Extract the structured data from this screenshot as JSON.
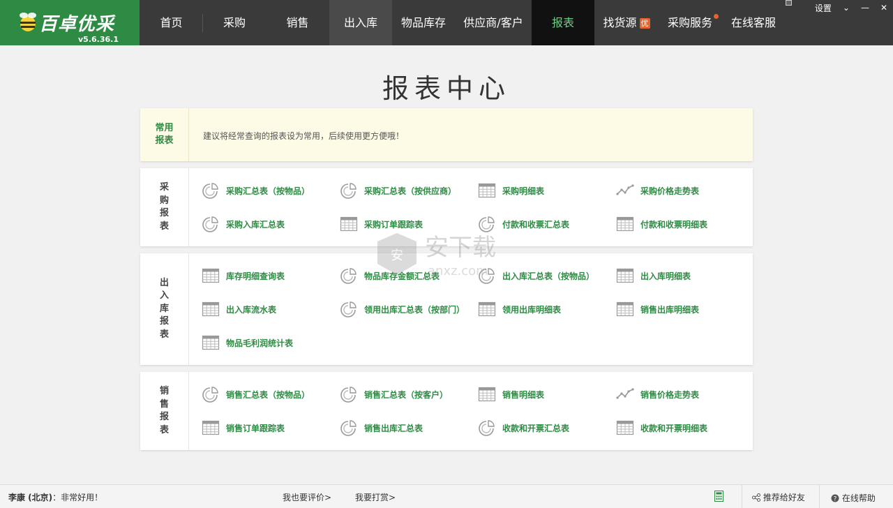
{
  "app": {
    "name": "百卓优采",
    "version": "v5.6.36.1"
  },
  "nav": [
    {
      "label": "首页"
    },
    {
      "label": "采购"
    },
    {
      "label": "销售"
    },
    {
      "label": "出入库"
    },
    {
      "label": "物品库存"
    },
    {
      "label": "供应商/客户"
    },
    {
      "label": "报表"
    },
    {
      "label": "找货源",
      "badge": "优"
    },
    {
      "label": "采购服务"
    },
    {
      "label": "在线客服"
    }
  ],
  "window": {
    "settings": "设置",
    "dropdown": "⌄",
    "minimize": "—",
    "close": "✕"
  },
  "title": "报表中心",
  "favorites": {
    "side": "常用报表",
    "tip": "建议将经常查询的报表设为常用，后续使用更方便哦！"
  },
  "sections": [
    {
      "side": [
        "采",
        "购",
        "报",
        "表"
      ],
      "items": [
        {
          "label": "采购汇总表（按物品）",
          "icon": "pie-chart-icon"
        },
        {
          "label": "采购汇总表（按供应商）",
          "icon": "pie-chart-icon"
        },
        {
          "label": "采购明细表",
          "icon": "table-grid-icon"
        },
        {
          "label": "采购价格走势表",
          "icon": "line-trend-icon"
        },
        {
          "label": "采购入库汇总表",
          "icon": "pie-chart-icon"
        },
        {
          "label": "采购订单跟踪表",
          "icon": "table-grid-icon"
        },
        {
          "label": "付款和收票汇总表",
          "icon": "pie-chart-icon"
        },
        {
          "label": "付款和收票明细表",
          "icon": "table-grid-icon"
        }
      ]
    },
    {
      "side": [
        "出",
        "入",
        "库",
        "报",
        "表"
      ],
      "items": [
        {
          "label": "库存明细查询表",
          "icon": "table-grid-icon"
        },
        {
          "label": "物品库存金额汇总表",
          "icon": "pie-chart-icon"
        },
        {
          "label": "出入库汇总表（按物品）",
          "icon": "pie-chart-icon"
        },
        {
          "label": "出入库明细表",
          "icon": "table-grid-icon"
        },
        {
          "label": "出入库流水表",
          "icon": "table-grid-icon"
        },
        {
          "label": "领用出库汇总表（按部门）",
          "icon": "pie-chart-icon"
        },
        {
          "label": "领用出库明细表",
          "icon": "table-grid-icon"
        },
        {
          "label": "销售出库明细表",
          "icon": "table-grid-icon"
        },
        {
          "label": "物品毛利润统计表",
          "icon": "table-grid-icon"
        }
      ]
    },
    {
      "side": [
        "销",
        "售",
        "报",
        "表"
      ],
      "items": [
        {
          "label": "销售汇总表（按物品）",
          "icon": "pie-chart-icon"
        },
        {
          "label": "销售汇总表（按客户）",
          "icon": "pie-chart-icon"
        },
        {
          "label": "销售明细表",
          "icon": "table-grid-icon"
        },
        {
          "label": "销售价格走势表",
          "icon": "line-trend-icon"
        },
        {
          "label": "销售订单跟踪表",
          "icon": "table-grid-icon"
        },
        {
          "label": "销售出库汇总表",
          "icon": "pie-chart-icon"
        },
        {
          "label": "收款和开票汇总表",
          "icon": "pie-chart-icon"
        },
        {
          "label": "收款和开票明细表",
          "icon": "table-grid-icon"
        }
      ]
    }
  ],
  "status": {
    "user": "李康 (北京)",
    "comment": "：非常好用！",
    "rate": "我也要评价>",
    "tip": "我要打赏>",
    "recommend": "推荐给好友",
    "help": "在线帮助"
  },
  "watermark": {
    "text_cn": "安下载",
    "text_en": "anxz.com"
  },
  "colors": {
    "brand": "#2e8b44",
    "topbar": "#3a3a3a",
    "active_nav": "#111111",
    "accent": "#e8632b"
  }
}
